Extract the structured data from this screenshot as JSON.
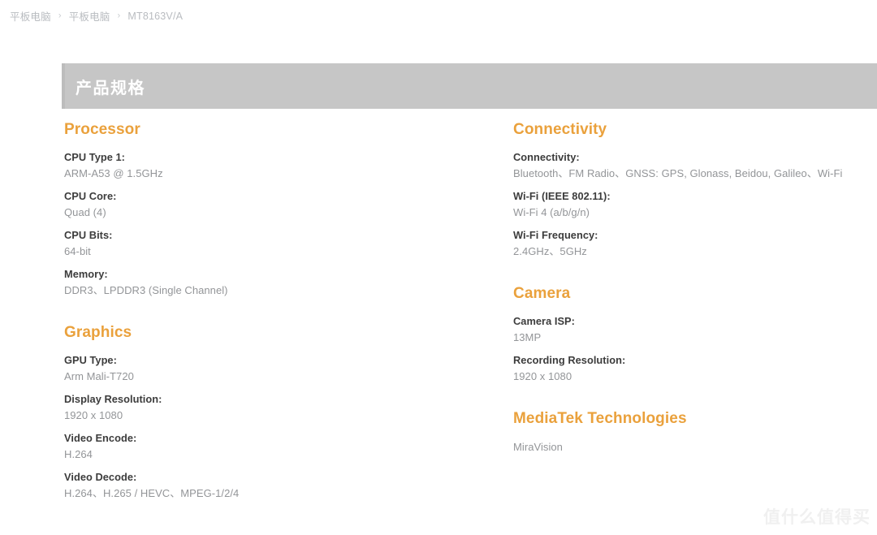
{
  "breadcrumb": {
    "separator": "›",
    "items": [
      {
        "label": "平板电脑"
      },
      {
        "label": "平板电脑"
      },
      {
        "label": "MT8163V/A"
      }
    ]
  },
  "banner": {
    "title": "产品规格",
    "background_color": "#c6c6c6",
    "text_color": "#ffffff"
  },
  "theme": {
    "accent_color": "#eaa13c",
    "label_color": "#3c3c3c",
    "value_color": "#939598",
    "page_background": "#ffffff"
  },
  "left_column": {
    "sections": [
      {
        "title": "Processor",
        "rows": [
          {
            "label": "CPU Type 1:",
            "value": "ARM-A53 @ 1.5GHz"
          },
          {
            "label": "CPU Core:",
            "value": "Quad (4)"
          },
          {
            "label": "CPU Bits:",
            "value": "64-bit"
          },
          {
            "label": "Memory:",
            "value": "DDR3、LPDDR3 (Single Channel)"
          }
        ]
      },
      {
        "title": "Graphics",
        "rows": [
          {
            "label": "GPU Type:",
            "value": "Arm Mali-T720"
          },
          {
            "label": "Display Resolution:",
            "value": "1920 x 1080"
          },
          {
            "label": "Video Encode:",
            "value": "H.264"
          },
          {
            "label": "Video Decode:",
            "value": "H.264、H.265 / HEVC、MPEG-1/2/4"
          }
        ]
      }
    ]
  },
  "right_column": {
    "sections": [
      {
        "title": "Connectivity",
        "rows": [
          {
            "label": "Connectivity:",
            "value": "Bluetooth、FM Radio、GNSS: GPS, Glonass, Beidou, Galileo、Wi-Fi"
          },
          {
            "label": "Wi-Fi (IEEE 802.11):",
            "value": "Wi-Fi 4 (a/b/g/n)"
          },
          {
            "label": "Wi-Fi Frequency:",
            "value": "2.4GHz、5GHz"
          }
        ]
      },
      {
        "title": "Camera",
        "rows": [
          {
            "label": "Camera ISP:",
            "value": "13MP"
          },
          {
            "label": "Recording Resolution:",
            "value": "1920 x 1080"
          }
        ]
      },
      {
        "title": "MediaTek Technologies",
        "rows": [
          {
            "label": "",
            "value": "MiraVision"
          }
        ]
      }
    ]
  },
  "watermark": {
    "text": "值什么值得买"
  }
}
